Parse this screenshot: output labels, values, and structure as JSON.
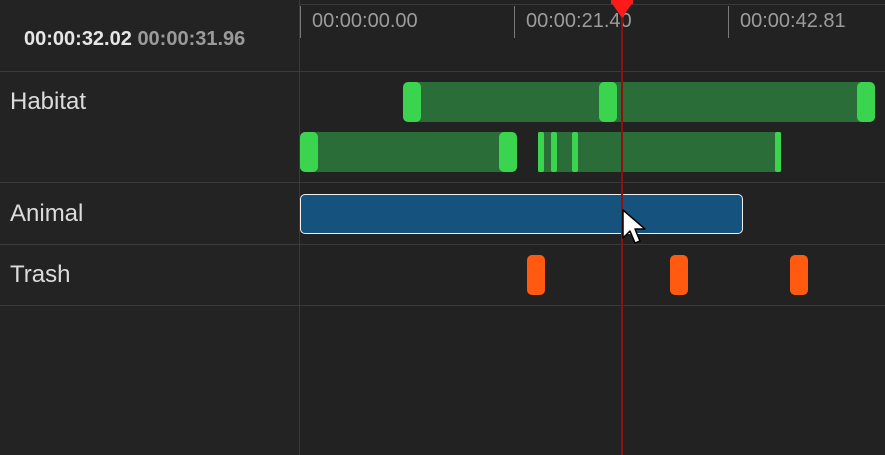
{
  "timecodes": {
    "current": "00:00:32.02",
    "secondary": "00:00:31.96"
  },
  "ruler": {
    "ticks": [
      "00:00:00.00",
      "00:00:21.40",
      "00:00:42.81"
    ]
  },
  "tracks": [
    {
      "label": "Habitat"
    },
    {
      "label": "Animal"
    },
    {
      "label": "Trash"
    }
  ],
  "colors": {
    "habitat_clip": "#2b6d38",
    "habitat_marker": "#3bd44f",
    "animal_clip": "#16527e",
    "trash_marker": "#ff5a10",
    "playhead": "#ff1a1a"
  },
  "icons": {
    "playhead": "playhead-marker-icon",
    "cursor": "mouse-pointer-icon"
  }
}
